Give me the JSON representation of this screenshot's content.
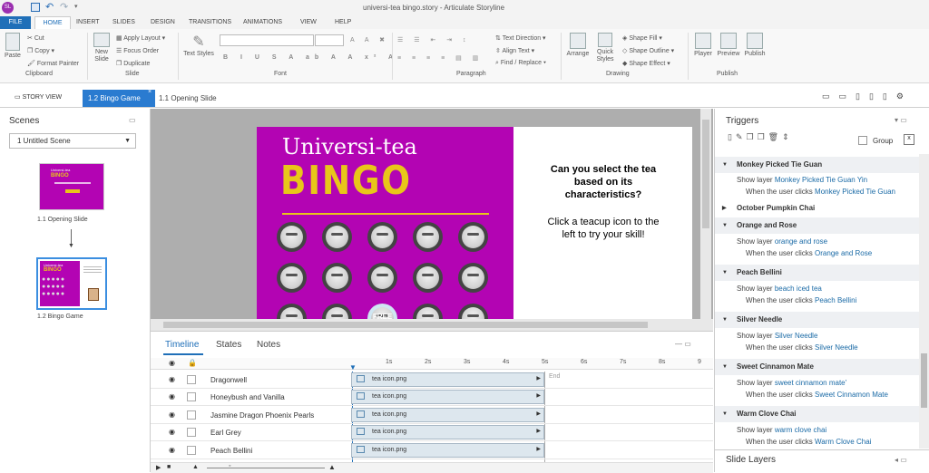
{
  "window": {
    "title": "universi-tea bingo.story - Articulate Storyline"
  },
  "menu_tabs": [
    "FILE",
    "HOME",
    "INSERT",
    "SLIDES",
    "DESIGN",
    "TRANSITIONS",
    "ANIMATIONS",
    "VIEW",
    "HELP"
  ],
  "ribbon": {
    "clipboard": {
      "paste": "Paste",
      "cut": "Cut",
      "copy": "Copy",
      "format_painter": "Format Painter",
      "group": "Clipboard"
    },
    "slide": {
      "new_slide": "New Slide",
      "apply_layout": "Apply Layout",
      "focus_order": "Focus Order",
      "duplicate": "Duplicate",
      "group": "Slide"
    },
    "font": {
      "text_styles": "Text Styles",
      "group": "Font"
    },
    "paragraph": {
      "text_direction": "Text Direction",
      "align_text": "Align Text",
      "find_replace": "Find / Replace",
      "group": "Paragraph"
    },
    "drawing": {
      "arrange": "Arrange",
      "quick_styles": "Quick Styles",
      "shape_fill": "Shape Fill",
      "shape_outline": "Shape Outline",
      "shape_effect": "Shape Effect",
      "group": "Drawing"
    },
    "publish": {
      "player": "Player",
      "preview": "Preview",
      "publish": "Publish",
      "group": "Publish"
    }
  },
  "story_tabs": {
    "story_view": "STORY VIEW",
    "active": "1.2 Bingo Game",
    "other": "1.1 Opening Slide"
  },
  "scenes": {
    "title": "Scenes",
    "scene_select": "1 Untitled Scene",
    "thumbs": [
      {
        "label": "1.1 Opening Slide",
        "thumb_title": "Universi-tea",
        "thumb_bingo": "BINGO"
      },
      {
        "label": "1.2 Bingo Game",
        "thumb_title": "Universi-tea",
        "thumb_bingo": "BINGO"
      }
    ]
  },
  "slide": {
    "title": "Universi-tea",
    "bingo": "BINGO",
    "free": "FREE",
    "question": "Can you select the tea based on its characteristics?",
    "instruction": "Click a teacup icon to the left to try your skill!",
    "colors": {
      "magenta": "#b304b3",
      "yellow": "#e8c61a"
    }
  },
  "timeline": {
    "tabs": [
      "Timeline",
      "States",
      "Notes"
    ],
    "ticks": [
      "1s",
      "2s",
      "3s",
      "4s",
      "5s",
      "6s",
      "7s",
      "8s",
      "9"
    ],
    "end": "End",
    "rows": [
      {
        "name": "Dragonwell",
        "clip": "tea icon.png"
      },
      {
        "name": "Honeybush and Vanilla",
        "clip": "tea icon.png"
      },
      {
        "name": "Jasmine Dragon Phoenix Pearls",
        "clip": "tea icon.png"
      },
      {
        "name": "Earl Grey",
        "clip": "tea icon.png"
      },
      {
        "name": "Peach Bellini",
        "clip": "tea icon.png"
      }
    ]
  },
  "triggers": {
    "title": "Triggers",
    "group_label": "Group",
    "first_head": "Monkey Picked Tie Guan",
    "first_line1_pre": "Show layer",
    "first_line1_val": "Monkey Picked Tie Guan Yin",
    "first_line2_pre": "When the user clicks",
    "first_line2_val": "Monkey Picked Tie Guan",
    "collapsed": "October Pumpkin Chai",
    "items": [
      {
        "head": "Orange and Rose",
        "layer": "orange and rose",
        "click": "Orange and Rose"
      },
      {
        "head": "Peach Bellini",
        "layer": "beach iced tea",
        "click": "Peach Bellini"
      },
      {
        "head": "Silver Needle",
        "layer": "Silver Needle",
        "click": "Silver Needle"
      },
      {
        "head": "Sweet Cinnamon Mate",
        "layer": "sweet cinnamon mate'",
        "click": "Sweet Cinnamon Mate"
      },
      {
        "head": "Warm Clove Chai",
        "layer": "warm clove chai",
        "click": "Warm Clove Chai"
      }
    ],
    "show_layer": "Show layer",
    "when_clicks": "When the user clicks"
  },
  "slide_layers": {
    "title": "Slide Layers"
  }
}
